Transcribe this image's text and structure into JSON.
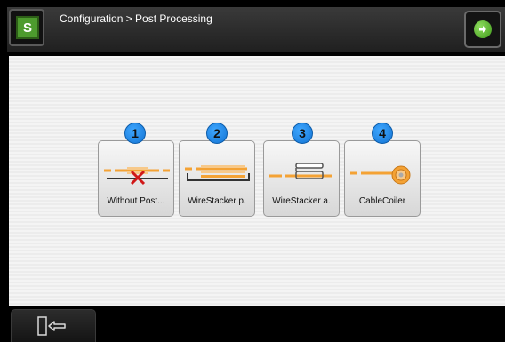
{
  "header": {
    "breadcrumb": "Configuration > Post Processing",
    "logo_text": "S"
  },
  "options": [
    {
      "number": "1",
      "label": "Without Post...",
      "icon": "without-post-processing-icon"
    },
    {
      "number": "2",
      "label": "WireStacker p.",
      "icon": "wirestacker-p-icon"
    },
    {
      "number": "3",
      "label": "WireStacker a.",
      "icon": "wirestacker-a-icon"
    },
    {
      "number": "4",
      "label": "CableCoiler",
      "icon": "cablecoiler-icon"
    }
  ],
  "colors": {
    "accent_green": "#4d9b2e",
    "badge_blue": "#1a86e8",
    "wire_orange": "#f4a234",
    "cross_red": "#d01818"
  }
}
